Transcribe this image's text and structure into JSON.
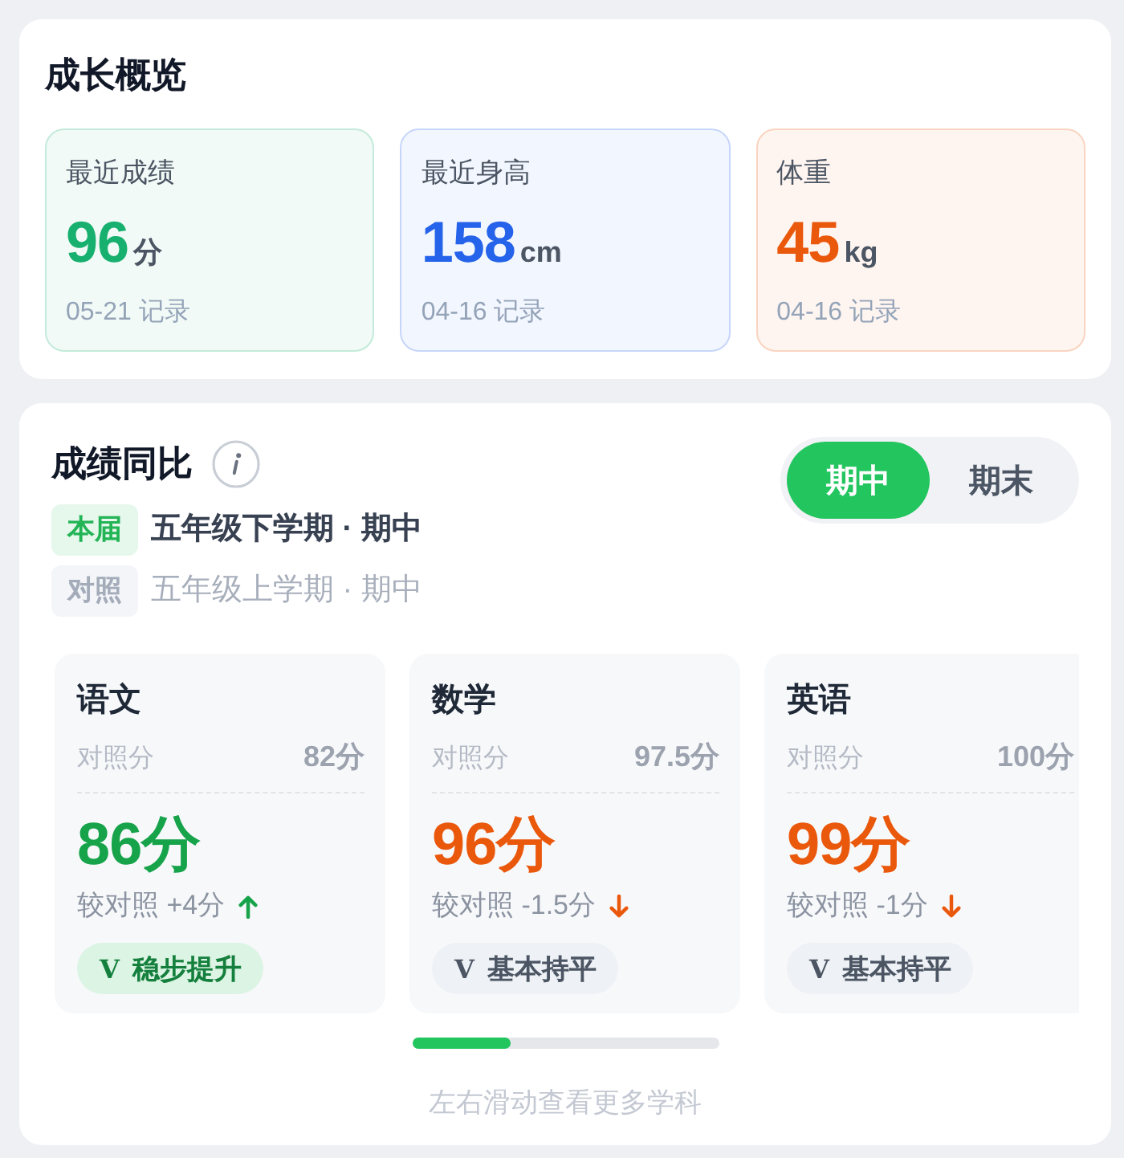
{
  "overview": {
    "title": "成长概览",
    "stats": [
      {
        "label": "最近成绩",
        "value": "96",
        "unit": "分",
        "note": "05-21 记录",
        "color": "#18b06f"
      },
      {
        "label": "最近身高",
        "value": "158",
        "unit": "cm",
        "note": "04-16 记录",
        "color": "#2563eb"
      },
      {
        "label": "体重",
        "value": "45",
        "unit": "kg",
        "note": "04-16 记录",
        "color": "#ea580c"
      }
    ]
  },
  "comparison": {
    "title": "成绩同比",
    "tabs": [
      {
        "label": "期中",
        "selected": true
      },
      {
        "label": "期末",
        "selected": false
      }
    ],
    "periods": [
      {
        "kind": "current",
        "tag": "本届",
        "text": "五年级下学期 · 期中"
      },
      {
        "kind": "baseline",
        "tag": "对照",
        "text": "五年级上学期 · 期中"
      }
    ],
    "subjects": [
      {
        "kind": "up",
        "name": "语文",
        "baseline_label": "对照分",
        "baseline_score": "82分",
        "score": "86分",
        "change": "较对照 +4分",
        "badge": {
          "kind": "rise",
          "mark": "V",
          "label": "稳步提升"
        }
      },
      {
        "kind": "down",
        "name": "数学",
        "baseline_label": "对照分",
        "baseline_score": "97.5分",
        "score": "96分",
        "change": "较对照 -1.5分",
        "badge": {
          "kind": "flat",
          "mark": "V",
          "label": "基本持平"
        }
      },
      {
        "kind": "down",
        "name": "英语",
        "baseline_label": "对照分",
        "baseline_score": "100分",
        "score": "99分",
        "change": "较对照 -1分",
        "badge": {
          "kind": "flat",
          "mark": "V",
          "label": "基本持平"
        }
      }
    ],
    "scroll_hint": "左右滑动查看更多学科"
  }
}
